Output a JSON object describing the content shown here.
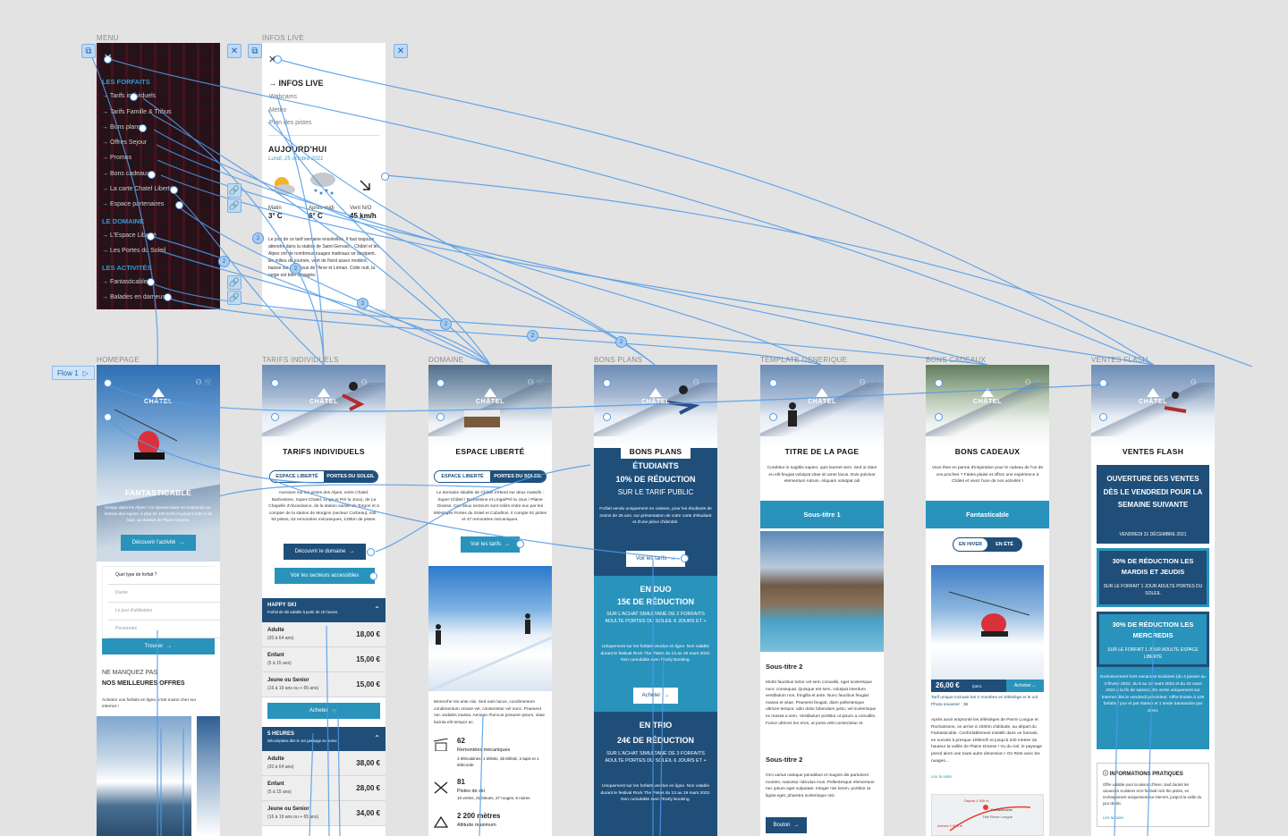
{
  "flow": {
    "label": "Flow 1"
  },
  "frames": {
    "menu": "MENU",
    "infos": "INFOS LIVE",
    "homepage": "HOMEPAGE",
    "tarifs": "TARIFS INDIVIDUELS",
    "domaine": "DOMAINE",
    "bons_plans": "BONS PLANS",
    "template": "TEMPLATE GENERIQUE",
    "bons_cadeaux": "BONS CADEAUX",
    "ventes_flash": "VENTES FLASH"
  },
  "menu": {
    "section1": "LES FORFAITS",
    "items1": [
      "Tarifs individuels",
      "Tarifs Famille & Tribus",
      "Bons plans",
      "Offres Sejour",
      "Promos",
      "Bons cadeaux",
      "La carte Chatel Liberté",
      "Espace partenaires"
    ],
    "section2": "LE DOMAINE",
    "items2": [
      "L'Espace Liberté",
      "Les Portes du Soleil"
    ],
    "section3": "LES ACTIVITÉS",
    "items3": [
      "Fantasticable",
      "Balades en dameuse"
    ]
  },
  "infos": {
    "heading": "INFOS LIVE",
    "links": [
      "Webcams",
      "Météo",
      "Plan des pistes"
    ],
    "today": "AUJOURD'HUI",
    "date": "Lundi, 25 octobre 2021",
    "weather": [
      {
        "label": "Matin",
        "value": "3° C"
      },
      {
        "label": "Après-midi",
        "value": "6° C"
      },
      {
        "label": "Vent N/O",
        "value": "45 km/h"
      }
    ],
    "text": "Le jour de ce tarif semaine ensoleillée. Il faut toujours attendre dans la station de Saint-Gervais... Châtel et les Alpes ont de nombreux nuages matinaux se dissipent. En milieu de journée, vent de Nord assez modéré, baisse sur le dessus de l'Arve et Léman. Cotte nuit, la neige est bien dégagée."
  },
  "home": {
    "title": "FANTASTICABLE",
    "desc": "Unique dans les Alpes ! Un spectaculaire vol suspendu au-dessus des sapins, à plus de 100 km/h et jusqu'à 240 m de haut, au-dessus de Plaine-Dranse.",
    "cta": "Découvrir l'activité",
    "q": "Quel type de forfait ?",
    "fields": [
      "Durée",
      "Le jour d'utilisation",
      "Personnes"
    ],
    "search": "Trouver",
    "kicker": "NE MANQUEZ PAS",
    "offers": "NOS MEILLEURES OFFRES",
    "offers_text": "Achetez vos forfaits en ligne, c'est moins cher sur internet !"
  },
  "tarifs": {
    "title": "TARIFS INDIVIDUELS",
    "tabs": [
      "ESPACE LIBERTÉ",
      "PORTES DU SOLEIL"
    ],
    "desc": "Aventure sur les pistes des Alpes, entre Chatel, Barbossine, Super-Chatel, Linga et Pré la Joux), de La Chapelle d'Abondance, de la station suisse de Torgon et à compter de la station de Morgins (secteur Corbeau), soit : 83 pistes, 63 remontées mécaniques, 130km de pistes.",
    "cta1": "Découvrir le domaine",
    "cta2": "Voir les secteurs accessibles",
    "p1": {
      "title": "HAPPY SKI",
      "sub": "Forfait de ski valable à partir de 15 heures.",
      "rows": [
        {
          "n": "Adulte",
          "a": "(20 à 64 ans)",
          "p": "18,00 €"
        },
        {
          "n": "Enfant",
          "a": "(5 à 15 ans)",
          "p": "15,00 €"
        },
        {
          "n": "Jeune ou Senior",
          "a": "(16 à 19 ans ou + 65 ans)",
          "p": "15,00 €"
        }
      ]
    },
    "buy": "Acheter",
    "p2": {
      "title": "5 HEURES",
      "sub": "Décomptées dès le 1er passage en borne",
      "rows": [
        {
          "n": "Adulte",
          "a": "(20 à 64 ans)",
          "p": "38,00 €"
        },
        {
          "n": "Enfant",
          "a": "(5 à 15 ans)",
          "p": "28,00 €"
        },
        {
          "n": "Jeune ou Senior",
          "a": "(16 à 19 ans ou + 65 ans)",
          "p": "34,00 €"
        }
      ]
    }
  },
  "domaine": {
    "title": "ESPACE LIBERTÉ",
    "tabs": [
      "ESPACE LIBERTÉ",
      "PORTES DU SOLEIL"
    ],
    "desc": "Le domaine skiable de Châtel s'étend sur deux massifs : Super-Châtel / Barbossine et Linga/Pré la Joux / Plaine Dranse. Ces deux secteurs sont reliés entre eux par les télésièges Portes du Soleil et Cubalhos. Il compte 81 pistes et 47 remontées mécaniques.",
    "cta": "Voir les tarifs",
    "text2": "Moreorhe nis ante nisi. Sed nam lacus, condimentum condimentum ornare vel, consectetur vel nunc. Praesent nec sodales massa. Aenean rhoncus posuere ipsum, vitae lacinia elit tempor ac.",
    "stats": [
      {
        "v": "62",
        "l": "Remontées mécaniques",
        "s": "3 télécabines, 1 téléski, 35 téléski, 2 tapis et 1 télécorde"
      },
      {
        "v": "81",
        "l": "Pistes de ski",
        "s": "10 vertes, 21 bleues, 27 rouges, 6 noires"
      },
      {
        "v": "2 200 mètres",
        "l": "Altitude maximum"
      }
    ]
  },
  "bons": {
    "title": "BONS PLANS",
    "b1": {
      "h1": "ÉTUDIANTS",
      "h2": "10% DE RÉDUCTION",
      "h3": "SUR LE TARIF PUBLIC",
      "t": "Forfait vendu uniquement en caisses, pour les étudiants de moins de 25 ans, sur présentation de votre carte d'étudiant et d'une pièce d'identité.",
      "cta": "Voir les tarifs"
    },
    "b2": {
      "h1": "EN DUO",
      "h2": "15€ DE RÉDUCTION",
      "h3": "SUR L'ACHAT SIMULTANÉ DE 2 FORFAITS ADULTE PORTES DU SOLEIL 6 JOURS ET +",
      "t": "Uniquement sur les forfaits vendus en ligne. Non valable durant le festival Rock The Pistes du 13 au 19 mars 2022. Non cumulable avec l'Early Booking.",
      "cta": "Acheter"
    },
    "b3": {
      "h1": "EN TRIO",
      "h2": "24€ DE RÉDUCTION",
      "h3": "SUR L'ACHAT SIMULTANÉ DE 3 FORFAITS ADULTE PORTES DU SOLEIL 6 JOURS ET +",
      "t": "Uniquement sur les forfaits vendus en ligne. Non valable durant le festival Rock The Pistes du 13 au 19 mars 2022. Non cumulable avec l'Early Booking."
    }
  },
  "template": {
    "title": "TITRE DE LA PAGE",
    "desc": "Curabitur in sagittis sapien, quis laoreet sem. Sed ut diam eu elit feugiat volutpat vitae sit amet lacus. Duis pulvinar elementum rutrum. Aliquam volutpat odi",
    "sub1": "Sous-titre 1",
    "sub2": "Sous-titre 2",
    "sub3": "Sous-titre 2",
    "t1": "Morbi faucibus tortor vel sem convallis, eget scelerisque nunc consequat. Quisque est sem, volutpat interdum vestibulum non, fringilla et ante. Nunc faucibus feugiat massa et vitae. Praesent feugiat, diam pellentesque ultrices tempor, odio dolor bibendum justo, vel scelerisque ex massa a sem. Vestibulum porttitor ut ipsum a convallis. Fusce ultrices leo eros, ut porta velit consectetur et.",
    "t2": "Orci varius natoque penatibus et magnis dis parturient montes, nascetur ridiculus mus. Pellentesque elementum nec ipsum eget vulputate. Integer nisi lorem, porttitor at ligula eget, pharetra scelerisque nisi.",
    "cta": "Bouton"
  },
  "cadeaux": {
    "title": "BONS CADEAUX",
    "desc": "Vous êtes en panne d'inspiration pour le cadeau de l'un de vos proches ? Faites plaisir et offrez une expérience à Châtel et vivez l'une de nos activités !",
    "band": "Fantasticable",
    "tabs": [
      "EN HIVER",
      "EN ÉTÉ"
    ],
    "price": "26,00 €",
    "unit": "/pers.",
    "buy": "Acheter",
    "note": "Tarif unique incluant les 2 montées en télésiège et le vol. Photo souvenir : 3€",
    "t": "Après avoir emprunté les télésièges de Pierre Longue et Rochassons, on arrive à 1930m d'altitude, au départ du Fantasticable. Confortablement installé dans un harnais, en survole à presque 100km/h et jusqu'à 240 mètres de hauteur la vallée de Plaine Dranse ! Vu du ciel, le paysage prend alors une toute autre dimension ! On Rirte avec les nuages...",
    "more": "Lire la suite",
    "map": [
      "Départ 1 930 m",
      "Fantasticable",
      "Arrivée 1 830 m",
      "Télé Pierre Longue"
    ]
  },
  "flash": {
    "title": "VENTES FLASH",
    "banner": "OUVERTURE DES VENTES DÈS LE VENDREDI POUR LA SEMAINE SUIVANTE",
    "date": "VENDREDI 31 DÉCEMBRE 2021",
    "o1": {
      "h": "30% DE RÉDUCTION LES MARDIS ET JEUDIS",
      "s": "SUR LE FORFAIT 1 JOUR ADULTE PORTES DU SOLEIL"
    },
    "o2": {
      "h": "30% DE RÉDUCTION LES MERCREDIS",
      "s": "SUR LE FORFAIT 1 JOUR ADULTE ESPACE LIBERTÉ"
    },
    "t": "Exclusivement hors vacances scolaires (du 4 janvier au 3 février 2022, du 8 au 10 mars 2022 et du 22 mars 2022 à la fin de saison). En vente uniquement sur Internet dès le vendredi précédent. Offre limitée à 100 forfaits / jour et par station et 1 seule transaction par client.",
    "info": "INFORMATIONS PRATIQUES",
    "info_t": "Offre valable pour la saison d'hiver, sauf durant les vacances scolaires et le festival rock the pistes, en rechargement uniquement sur internet, jusqu'à la veille du jour de ski.",
    "more": "Lire la suite"
  },
  "badges": [
    "2",
    "2",
    "2",
    "2",
    "2",
    "2",
    "2"
  ],
  "colors": {
    "navy": "#1f4e79",
    "teal": "#2a93bc",
    "connector": "#4e9ae8",
    "menu_accent": "#2f9bd0"
  }
}
